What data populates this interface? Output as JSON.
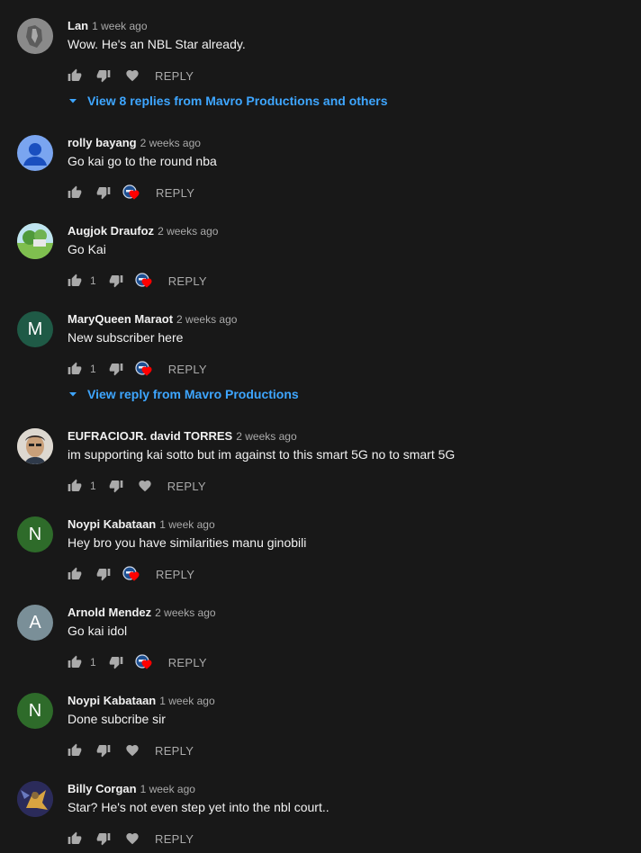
{
  "comments": [
    {
      "author": "Lan",
      "time": "1 week ago",
      "text": "Wow. He's an NBL Star already.",
      "likes": "",
      "creator_heart": false,
      "reply_label": "REPLY",
      "avatar": {
        "type": "image-gray"
      },
      "replies_link": "View 8 replies from Mavro Productions and others"
    },
    {
      "author": "rolly bayang",
      "time": "2 weeks ago",
      "text": "Go kai go to the round nba",
      "likes": "",
      "creator_heart": true,
      "reply_label": "REPLY",
      "avatar": {
        "type": "default-person",
        "color": "#7aa5f0"
      }
    },
    {
      "author": "Augjok Draufoz",
      "time": "2 weeks ago",
      "text": "Go Kai",
      "likes": "1",
      "creator_heart": true,
      "reply_label": "REPLY",
      "avatar": {
        "type": "image-landscape"
      }
    },
    {
      "author": "MaryQueen Maraot",
      "time": "2 weeks ago",
      "text": "New subscriber here",
      "likes": "1",
      "creator_heart": true,
      "reply_label": "REPLY",
      "avatar": {
        "type": "letter",
        "letter": "M",
        "color": "#1f5a46"
      },
      "replies_link": "View reply from Mavro Productions"
    },
    {
      "author": "EUFRACIOJR. david TORRES",
      "time": "2 weeks ago",
      "text": "im supporting kai sotto but im against to this smart 5G no to smart 5G",
      "likes": "1",
      "creator_heart": false,
      "reply_label": "REPLY",
      "avatar": {
        "type": "image-face"
      }
    },
    {
      "author": "Noypi Kabataan",
      "time": "1 week ago",
      "text": "Hey bro you have similarities manu ginobili",
      "likes": "",
      "creator_heart": true,
      "reply_label": "REPLY",
      "avatar": {
        "type": "letter",
        "letter": "N",
        "color": "#2e6b2a"
      }
    },
    {
      "author": "Arnold Mendez",
      "time": "2 weeks ago",
      "text": "Go kai idol",
      "likes": "1",
      "creator_heart": true,
      "reply_label": "REPLY",
      "avatar": {
        "type": "letter",
        "letter": "A",
        "color": "#7a8f98"
      }
    },
    {
      "author": "Noypi Kabataan",
      "time": "1 week ago",
      "text": "Done subcribe sir",
      "likes": "",
      "creator_heart": false,
      "reply_label": "REPLY",
      "avatar": {
        "type": "letter",
        "letter": "N",
        "color": "#2e6b2a"
      }
    },
    {
      "author": "Billy Corgan",
      "time": "1 week ago",
      "text": "Star? He's not even step yet into the nbl court..",
      "likes": "",
      "creator_heart": false,
      "reply_label": "REPLY",
      "avatar": {
        "type": "image-game"
      }
    }
  ],
  "colors": {
    "background": "#181818",
    "link": "#3ea6ff",
    "heart_red": "#ff0000",
    "text_secondary": "#aaaaaa"
  }
}
